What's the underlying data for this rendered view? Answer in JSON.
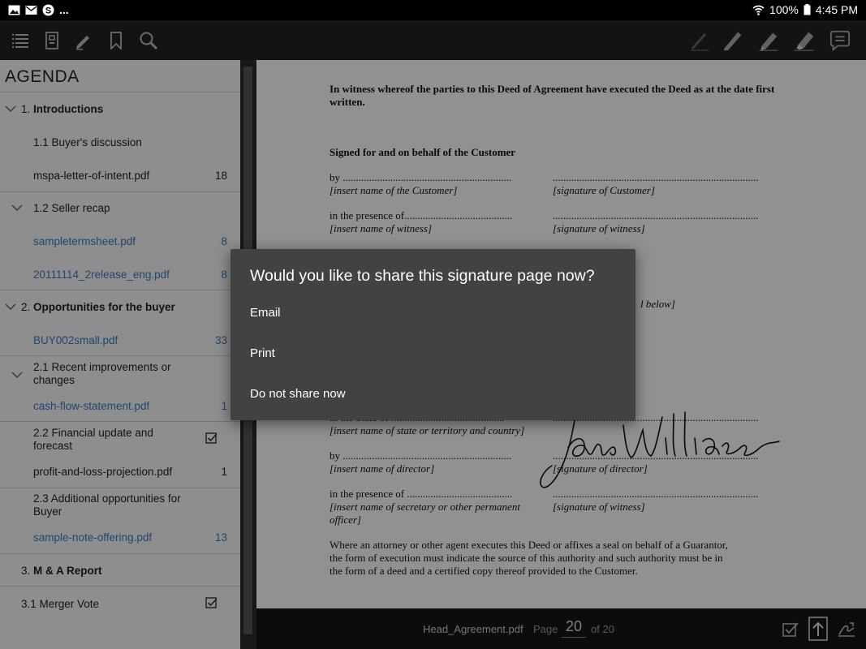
{
  "status_bar": {
    "battery": "100%",
    "time": "4:45 PM",
    "overflow": "..."
  },
  "toolbar": {
    "left_icons": [
      "list-icon",
      "bookmarks-panel-icon",
      "pen-icon",
      "bookmark-icon",
      "search-icon"
    ],
    "right_icons": [
      "pencil-thin-icon",
      "pencil-icon",
      "marker-icon",
      "highlighter-icon",
      "comment-icon"
    ]
  },
  "sidebar": {
    "title": "AGENDA",
    "items": [
      {
        "num": "1.",
        "label": "Introductions",
        "bold": true,
        "level": 0,
        "expand": true,
        "page": ""
      },
      {
        "num": "",
        "label": "1.1 Buyer's discussion",
        "level": 1,
        "page": ""
      },
      {
        "num": "",
        "label": "mspa-letter-of-intent.pdf",
        "level": 1,
        "page": "18"
      },
      {
        "num": "",
        "label": "1.2 Seller recap",
        "level": 1,
        "expand": true,
        "page": ""
      },
      {
        "num": "",
        "label": "sampletermsheet.pdf",
        "level": 1,
        "link": true,
        "page": "8"
      },
      {
        "num": "",
        "label": "20111114_2release_eng.pdf",
        "level": 1,
        "link": true,
        "page": "8"
      },
      {
        "num": "2.",
        "label": "Opportunities for the buyer",
        "bold": true,
        "level": 0,
        "expand": true,
        "page": ""
      },
      {
        "num": "",
        "label": "BUY002small.pdf",
        "level": 1,
        "link": true,
        "page": "33"
      },
      {
        "num": "",
        "label": "2.1 Recent improvements or",
        "label2": "changes",
        "level": 1,
        "expand": true,
        "page": ""
      },
      {
        "num": "",
        "label": "cash-flow-statement.pdf",
        "level": 1,
        "link": true,
        "page": "1"
      },
      {
        "num": "",
        "label": "2.2 Financial update and",
        "label2": "forecast",
        "level": 1,
        "checked": true,
        "page": ""
      },
      {
        "num": "",
        "label": "profit-and-loss-projection.pdf",
        "level": 1,
        "page": "1"
      },
      {
        "num": "",
        "label": "2.3 Additional opportunities for",
        "label2": "Buyer",
        "level": 1,
        "page": ""
      },
      {
        "num": "",
        "label": "sample-note-offering.pdf",
        "level": 1,
        "link": true,
        "page": "13"
      },
      {
        "num": "3.",
        "label": "M & A Report",
        "bold": true,
        "level": 0,
        "page": ""
      },
      {
        "num": "",
        "label": "3.1 Merger Vote",
        "level": 0,
        "checked": true,
        "page": ""
      }
    ]
  },
  "document": {
    "intro": "In witness whereof the parties to this Deed of Agreement have executed the Deed as at the date first",
    "intro2": "written.",
    "signed_for": "Signed for and on behalf of the Customer",
    "by_line": "by ................................................................",
    "dots_line": "..............................................................................",
    "insert_customer": "[insert name of the Customer]",
    "sig_customer": "[signature of Customer]",
    "presence_line": "in the presence of.........................................",
    "insert_witness": "[insert name of witness]",
    "sig_witness": "[signature of witness]",
    "partial_below": "l below]",
    "partial_state_line": "in the State of ...........................................",
    "insert_state": "[insert name of state or territory and country]",
    "by_line2": "by ................................................................",
    "insert_director": "[insert name of director]",
    "sig_director": "[signature of director]",
    "presence_line2": "in the presence of ........................................",
    "insert_secretary": "[insert name of secretary or other permanent",
    "insert_secretary2": "officer]",
    "sig_witness2": "[signature of witness]",
    "para1": "Where an attorney or other agent executes this Deed or affixes a seal on behalf of a Guarantor,",
    "para2": "the form of execution must indicate the source of this authority and such authority must be in",
    "para3": "the form of a deed and a certified copy thereof provided to the Customer."
  },
  "bottom_bar": {
    "filename": "Head_Agreement.pdf",
    "page_label": "Page",
    "page_number": "20",
    "page_of": "of 20"
  },
  "dialog": {
    "title": "Would you like to share this signature page now?",
    "options": [
      "Email",
      "Print",
      "Do not share now"
    ]
  }
}
